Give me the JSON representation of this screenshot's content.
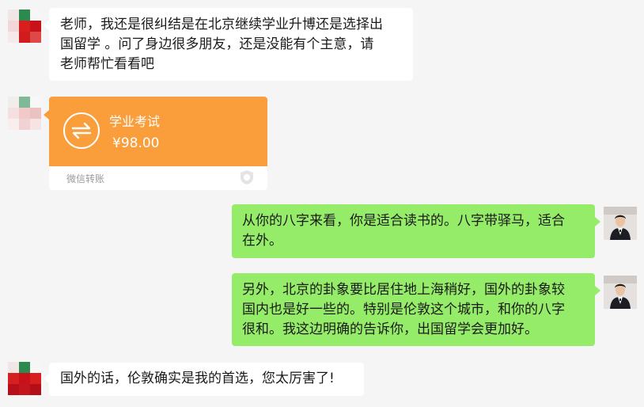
{
  "colors": {
    "background": "#f5f5f5",
    "bubble_left": "#ffffff",
    "bubble_right": "#95ec69",
    "transfer_orange": "#fa9d3b"
  },
  "messages": [
    {
      "side": "left",
      "text_lines": [
        "老师，我还是很纠结是在北京继续学业升博还是选择出",
        "国留学 。问了身边很多朋友，还是没能有个主意，请",
        "老师帮忙看看吧"
      ]
    },
    {
      "side": "right",
      "text_lines": [
        "从你的八字来看，你是适合读书的。八字带驿马，适合",
        "在外。"
      ]
    },
    {
      "side": "right",
      "text_lines": [
        "另外，北京的卦象要比居住地上海稍好，国外的卦象较",
        "国内也是好一些的。特别是伦敦这个城市，和你的八字",
        "很和。我这边明确的告诉你，出国留学会更加好。"
      ]
    },
    {
      "side": "left",
      "text_lines": [
        "国外的话，伦敦确实是我的首选，您太厉害了!"
      ]
    }
  ],
  "transfer": {
    "title": "学业考试",
    "amount": "¥98.00",
    "label": "微信转账",
    "icon": "transfer-arrows-icon"
  },
  "avatars": {
    "left": "avatar-pixelated",
    "right": "avatar-man-in-suit"
  }
}
